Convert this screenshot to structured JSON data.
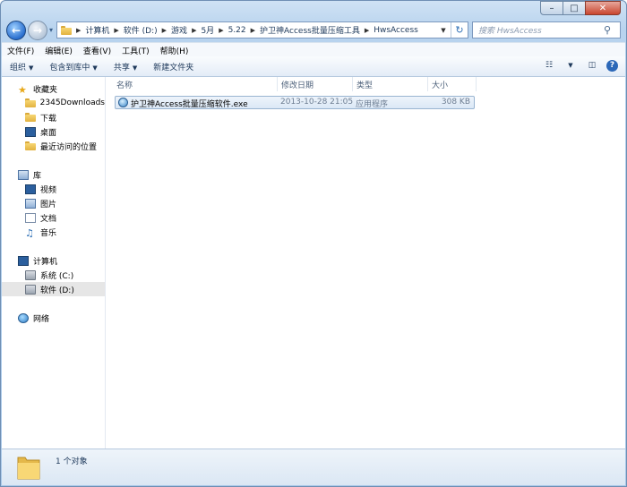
{
  "window": {
    "caption_min": "–",
    "caption_max": "□",
    "caption_close": "✕"
  },
  "address": {
    "crumbs": [
      "计算机",
      "软件 (D:)",
      "游戏",
      "5月",
      "5.22",
      "护卫神Access批量压缩工具",
      "HwsAccess"
    ],
    "search_placeholder": "搜索 HwsAccess"
  },
  "menubar": {
    "items": [
      "文件(F)",
      "编辑(E)",
      "查看(V)",
      "工具(T)",
      "帮助(H)"
    ]
  },
  "toolbar": {
    "organize": "组织",
    "include_library": "包含到库中",
    "share": "共享",
    "new_folder": "新建文件夹",
    "help": "?"
  },
  "nav": {
    "favorites": "收藏夹",
    "downloads2345": "2345Downloads",
    "downloads": "下载",
    "desktop": "桌面",
    "recent": "最近访问的位置",
    "libraries": "库",
    "videos": "视频",
    "pictures": "图片",
    "documents": "文档",
    "music": "音乐",
    "computer": "计算机",
    "drive_c": "系统 (C:)",
    "drive_d": "软件 (D:)",
    "network": "网络"
  },
  "columns": {
    "name": "名称",
    "date": "修改日期",
    "type": "类型",
    "size": "大小"
  },
  "files": [
    {
      "name": "护卫神Access批量压缩软件.exe",
      "date": "2013-10-28 21:05",
      "type": "应用程序",
      "size": "308 KB"
    }
  ],
  "status": {
    "count": "1 个对象"
  }
}
